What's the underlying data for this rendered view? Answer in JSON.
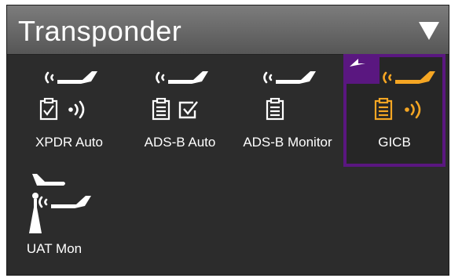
{
  "header": {
    "title": "Transponder",
    "dropdown_icon": "triangle-down-icon"
  },
  "colors": {
    "background": "#2c2c2c",
    "header": "#6a6a6a",
    "selected_outline": "#5a1780",
    "accent": "#f5a623",
    "icon": "#ffffff"
  },
  "tiles": [
    {
      "label": "XPDR Auto",
      "icons": [
        "aircraft-signal-icon",
        "checklist-icon",
        "signal-waves-icon"
      ]
    },
    {
      "label": "ADS-B Auto",
      "icons": [
        "aircraft-signal-icon",
        "checklist-icon",
        "checkbox-checked-icon"
      ]
    },
    {
      "label": "ADS-B Monitor",
      "icons": [
        "aircraft-signal-icon",
        "checklist-icon"
      ]
    },
    {
      "label": "GICB",
      "selected": true,
      "icons": [
        "back-arrow-icon",
        "aircraft-signal-icon",
        "checklist-icon",
        "signal-waves-icon"
      ]
    },
    {
      "label": "UAT Mon",
      "icons": [
        "aircraft-icon",
        "antenna-icon",
        "aircraft-signal-icon"
      ]
    }
  ]
}
